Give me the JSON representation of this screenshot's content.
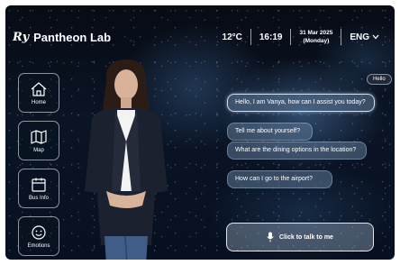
{
  "brand": {
    "logo_mark": "Ry",
    "name": "Pantheon Lab"
  },
  "status": {
    "temperature": "12°C",
    "time": "16:19",
    "date": "31 Mar 2025",
    "weekday": "(Monday)",
    "language": "ENG"
  },
  "nav": [
    {
      "label": "Home",
      "icon": "home-icon"
    },
    {
      "label": "Map",
      "icon": "map-icon"
    },
    {
      "label": "Bus Info",
      "icon": "calendar-icon"
    },
    {
      "label": "Emotions",
      "icon": "smiley-icon"
    }
  ],
  "chat": {
    "user_greeting": "Hello",
    "messages": [
      "Hello, I am Vanya, how can I assist you today?",
      "Tell me about yourself?",
      "What are the dining options in the location?",
      "How can I go to the airport?"
    ]
  },
  "talk_button": {
    "label": "Click to talk to me",
    "icon": "microphone-icon"
  },
  "colors": {
    "background": "#0a1424",
    "accent": "#ffffff"
  }
}
